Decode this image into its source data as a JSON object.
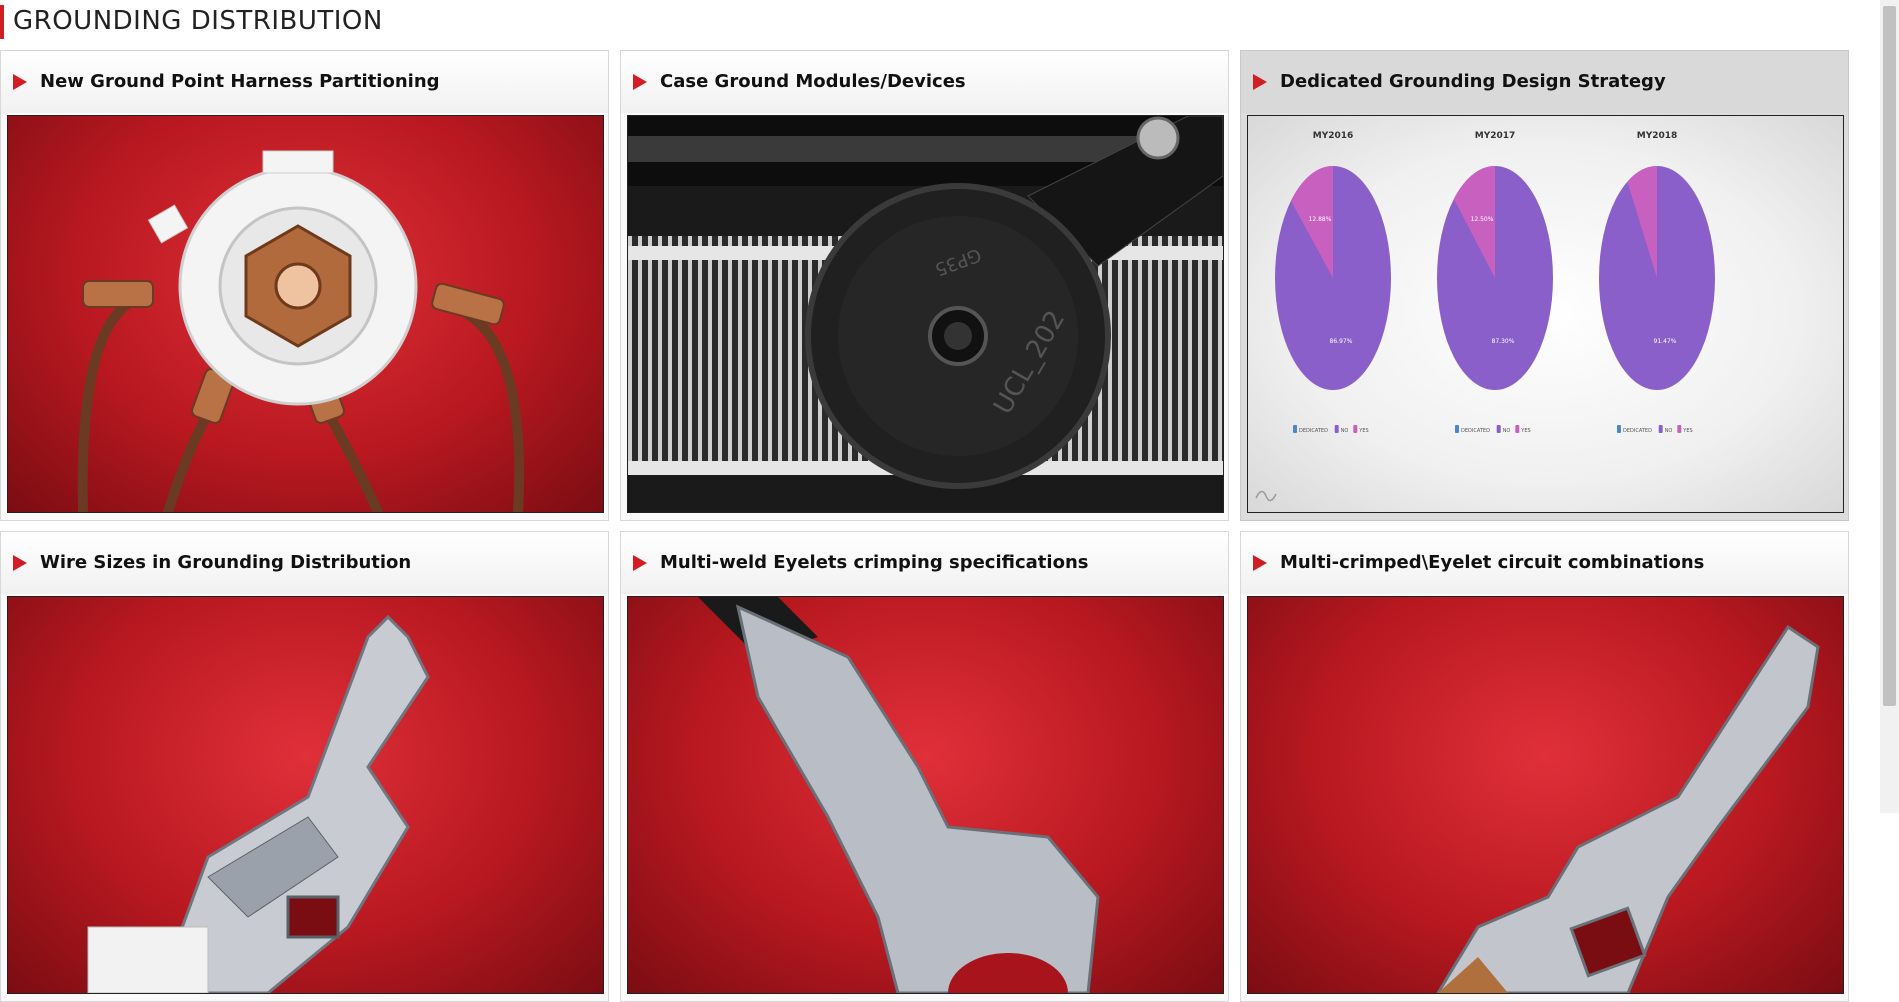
{
  "header": {
    "title": "GROUNDING DISTRIBUTION"
  },
  "cards": [
    {
      "title": "New Ground Point Harness Partitioning"
    },
    {
      "title": "Case Ground Modules/Devices"
    },
    {
      "title": "Dedicated Grounding Design Strategy"
    },
    {
      "title": "Wire Sizes in Grounding Distribution"
    },
    {
      "title": "Multi-weld Eyelets crimping specifications"
    },
    {
      "title": "Multi-crimped\\Eyelet circuit combinations"
    }
  ],
  "device_text": {
    "line1": "GP35",
    "line2": "UCL_202"
  },
  "chart_data": [
    {
      "type": "pie",
      "title": "MY2016",
      "categories": [
        "DEDICATED",
        "NO",
        "YES"
      ],
      "values": [
        0,
        86.97,
        12.88
      ],
      "data_labels": [
        "86.97%",
        "12.88%"
      ]
    },
    {
      "type": "pie",
      "title": "MY2017",
      "categories": [
        "DEDICATED",
        "NO",
        "YES"
      ],
      "values": [
        0,
        87.3,
        12.5
      ],
      "data_labels": [
        "87.30%",
        "12.50%"
      ]
    },
    {
      "type": "pie",
      "title": "MY2018",
      "categories": [
        "DEDICATED",
        "NO",
        "YES"
      ],
      "values": [
        0,
        91.47,
        8.53
      ],
      "data_labels": [
        "91.47%"
      ]
    }
  ],
  "pie_colors": {
    "dedicated": "#4a86c8",
    "no": "#8a5fc9",
    "yes": "#c860c0"
  },
  "colors": {
    "accent": "#d31d25"
  }
}
